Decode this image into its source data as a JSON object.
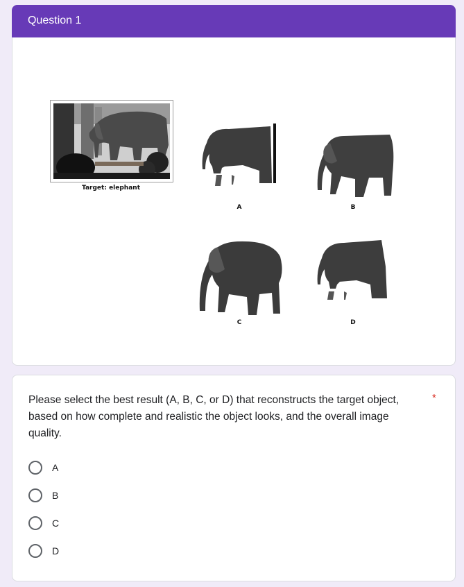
{
  "section": {
    "title": "Question 1"
  },
  "target": {
    "caption": "Target: elephant"
  },
  "candidates": [
    {
      "label": "A",
      "icon": "elephant-partial-icon"
    },
    {
      "label": "B",
      "icon": "elephant-complete-icon"
    },
    {
      "label": "C",
      "icon": "elephant-large-icon"
    },
    {
      "label": "D",
      "icon": "elephant-partial-icon"
    }
  ],
  "question": {
    "text": "Please select the best result (A, B, C, or D) that reconstructs the target object, based on how complete and realistic the object looks, and the overall image quality.",
    "required_mark": "*",
    "options": [
      "A",
      "B",
      "C",
      "D"
    ],
    "selected": null
  },
  "colors": {
    "header": "#673ab7",
    "background": "#f0ebf8",
    "required": "#d93025"
  }
}
